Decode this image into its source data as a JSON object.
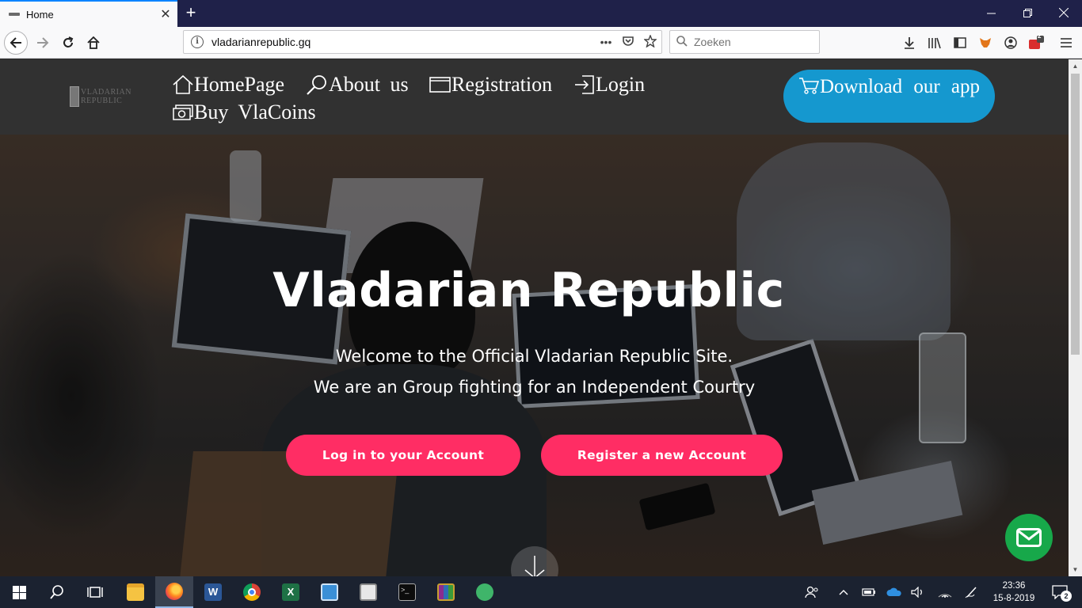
{
  "browser": {
    "tab_title": "Home",
    "tab_close": "✕",
    "new_tab": "+",
    "url": "vladarianrepublic.gq",
    "search_placeholder": "Zoeken",
    "page_actions": "•••",
    "notification_badge": "2"
  },
  "site": {
    "logo_line1": "VLADARIAN",
    "logo_line2": "REPUBLIC",
    "nav": [
      {
        "label": "HomePage",
        "icon": "home-icon"
      },
      {
        "label": "About us",
        "icon": "search-icon"
      },
      {
        "label": "Registration",
        "icon": "window-icon"
      },
      {
        "label": "Login",
        "icon": "login-icon"
      },
      {
        "label": "Buy VlaCoins",
        "icon": "money-icon"
      }
    ],
    "download_label": "Download our app",
    "hero": {
      "title": "Vladarian Republic",
      "line1": "Welcome to the Official Vladarian Republic Site.",
      "line2": "We are an Group fighting for an Independent Courtry",
      "login_button": "Log in to your Account",
      "register_button": "Register a new Account"
    }
  },
  "taskbar": {
    "time": "23:36",
    "date": "15-8-2019",
    "notification_count": "2"
  },
  "colors": {
    "tabbar": "#1f2149",
    "header": "#313131",
    "download": "#1598cf",
    "pill": "#ff2d64",
    "mail": "#17a84a"
  }
}
